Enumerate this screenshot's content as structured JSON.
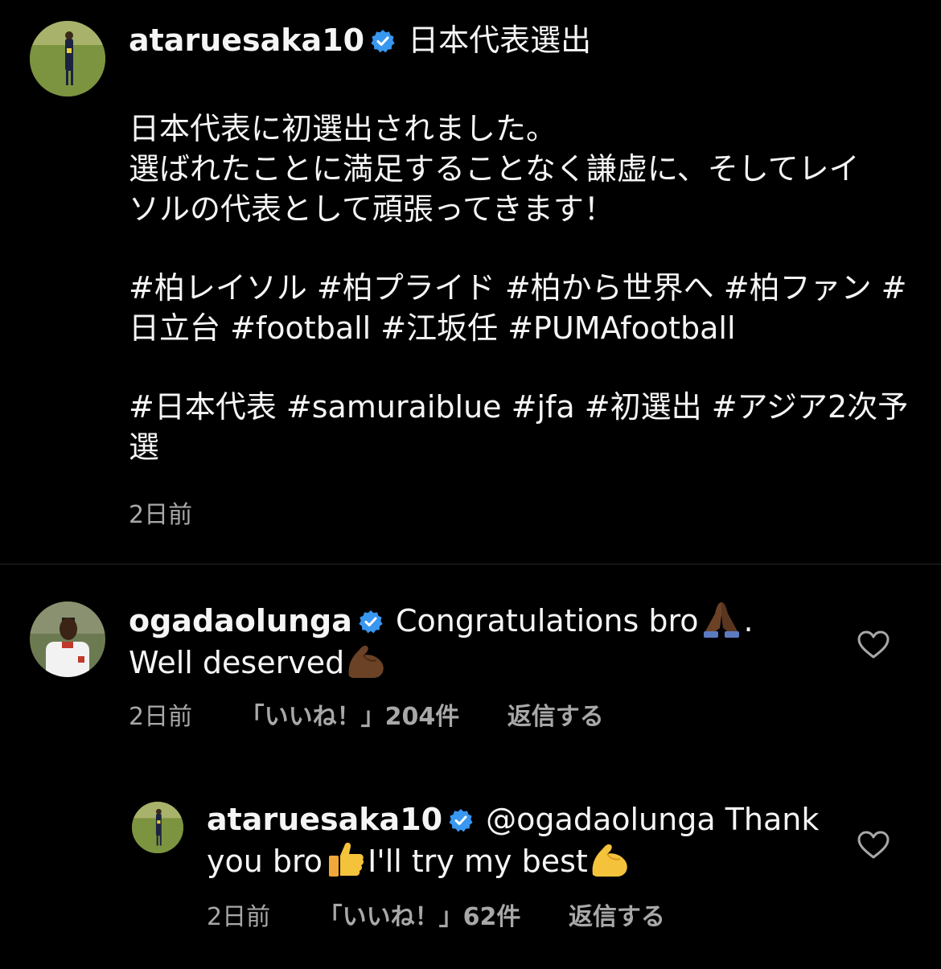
{
  "caption": {
    "username": "ataruesaka10",
    "title": "日本代表選出",
    "lines": [
      [
        "日本代表に初選出されました。",
        "選ばれたことに満足することなく謙虚に、そしてレイ",
        "ソルの代表として頑張ってきます！"
      ],
      [
        "#柏レイソル #柏プライド #柏から世界へ #柏ファン #",
        "日立台 #football #江坂任 #PUMAfootball"
      ],
      [
        "#日本代表 #samuraiblue #jfa #初選出 #アジア2次予",
        "選"
      ]
    ],
    "time": "2日前"
  },
  "comments": [
    {
      "username": "ogadaolunga",
      "text_part1": "Congratulations bro",
      "text_part2": ".",
      "text_part3": "Well deserved",
      "time": "2日前",
      "likes": "「いいね！」204件",
      "reply": "返信する"
    },
    {
      "username": "ataruesaka10",
      "text_part1": "@ogadaolunga Thank",
      "text_part2": "you bro",
      "text_part3": "I'll try my best",
      "time": "2日前",
      "likes": "「いいね！」62件",
      "reply": "返信する"
    }
  ],
  "icons": {
    "verified": "verified-badge-icon",
    "heart": "heart-outline-icon",
    "pray": "folded-hands-emoji",
    "muscle": "flexed-biceps-emoji",
    "thumbs": "thumbs-up-emoji"
  },
  "colors": {
    "background": "#000000",
    "text": "#f5f5f5",
    "secondary": "#a8a8a8",
    "verified": "#3897f0"
  }
}
